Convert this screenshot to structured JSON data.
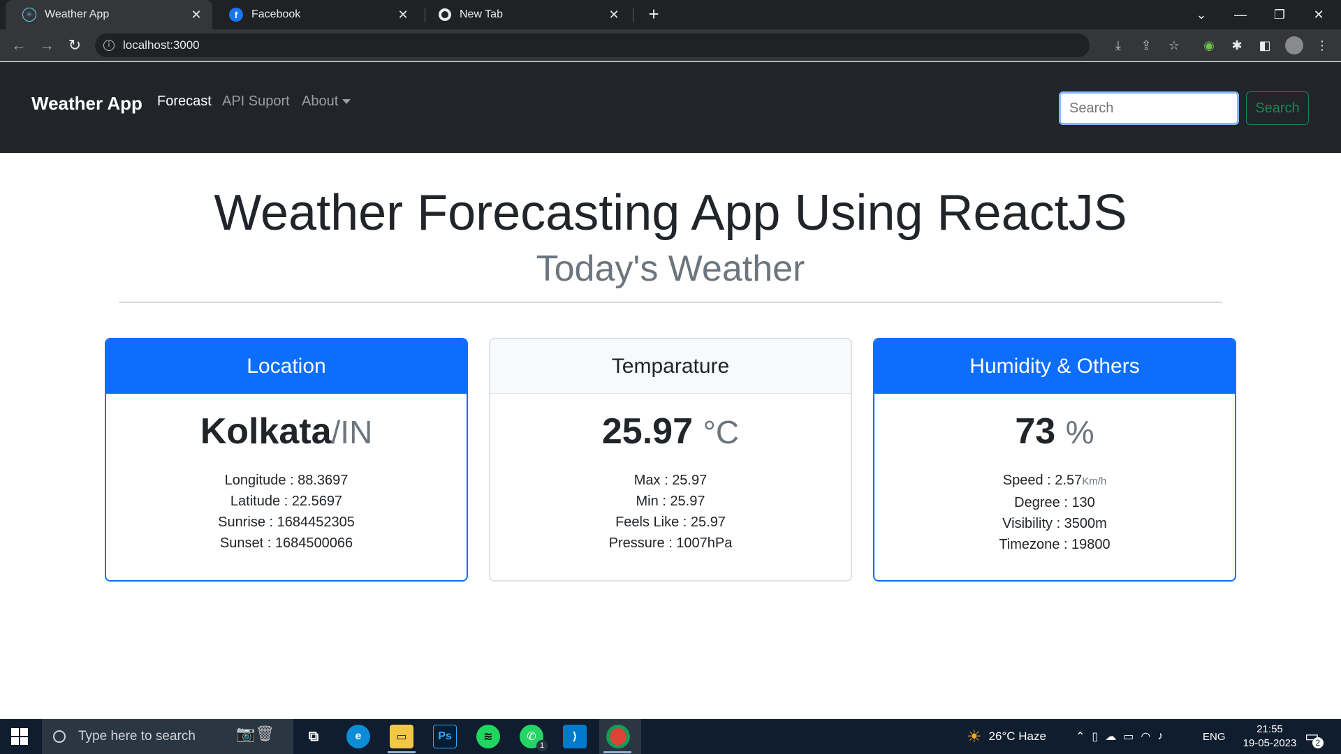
{
  "browser": {
    "tabs": [
      {
        "title": "Weather App",
        "icon": "react-icon"
      },
      {
        "title": "Facebook",
        "icon": "facebook-icon"
      },
      {
        "title": "New Tab",
        "icon": "chrome-icon"
      }
    ],
    "url": "localhost:3000"
  },
  "navbar": {
    "brand": "Weather App",
    "links": [
      "Forecast",
      "API Suport",
      "About"
    ],
    "search_placeholder": "Search",
    "search_button": "Search"
  },
  "page": {
    "title": "Weather Forecasting App Using ReactJS",
    "subtitle": "Today's Weather"
  },
  "cards": {
    "location": {
      "header": "Location",
      "city": "Kolkata",
      "country": "/IN",
      "details": [
        "Longitude : 88.3697",
        "Latitude : 22.5697",
        "Sunrise : 1684452305",
        "Sunset : 1684500066"
      ]
    },
    "temperature": {
      "header": "Temparature",
      "value": "25.97",
      "unit": "°C",
      "details": [
        "Max : 25.97",
        "Min : 25.97",
        "Feels Like : 25.97",
        "Pressure : 1007hPa"
      ]
    },
    "humidity": {
      "header": "Humidity & Others",
      "value": "73",
      "unit": "%",
      "speed_label": "Speed : 2.57",
      "speed_unit": "Km/h",
      "details": [
        "Degree : 130",
        "Visibility : 3500m",
        "Timezone : 19800"
      ]
    }
  },
  "taskbar": {
    "search_placeholder": "Type here to search",
    "weather": "26°C  Haze",
    "language": "ENG",
    "time": "21:55",
    "date": "19-05-2023",
    "notification_count": "2",
    "whatsapp_badge": "1"
  },
  "colors": {
    "primary": "#0d6efd",
    "navbar_bg": "#212529",
    "success": "#198754"
  }
}
